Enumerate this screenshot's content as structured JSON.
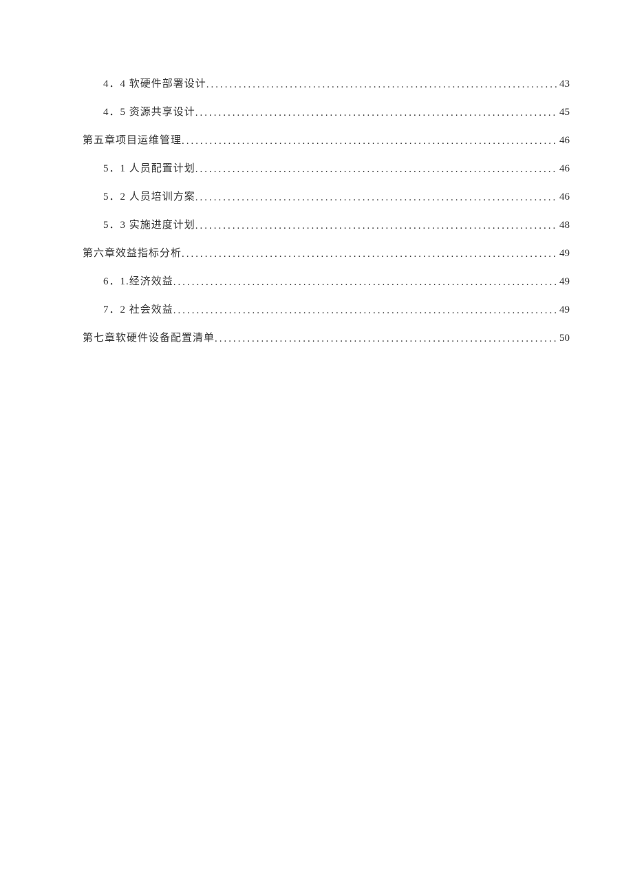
{
  "toc": [
    {
      "indent": true,
      "label": "4．4 软硬件部署设计",
      "page": "43"
    },
    {
      "indent": true,
      "label": "4．5 资源共享设计",
      "page": "45"
    },
    {
      "indent": false,
      "label": "第五章项目运维管理",
      "page": "46"
    },
    {
      "indent": true,
      "label": "5．1 人员配置计划",
      "page": "46"
    },
    {
      "indent": true,
      "label": "5．2 人员培训方案",
      "page": "46"
    },
    {
      "indent": true,
      "label": "5．3 实施进度计划",
      "page": "48"
    },
    {
      "indent": false,
      "label": "第六章效益指标分析",
      "page": "49"
    },
    {
      "indent": true,
      "label": "6．1.经济效益",
      "page": "49"
    },
    {
      "indent": true,
      "label": "7．2 社会效益",
      "page": "49"
    },
    {
      "indent": false,
      "label": "第七章软硬件设备配置清单",
      "page": "50"
    }
  ]
}
